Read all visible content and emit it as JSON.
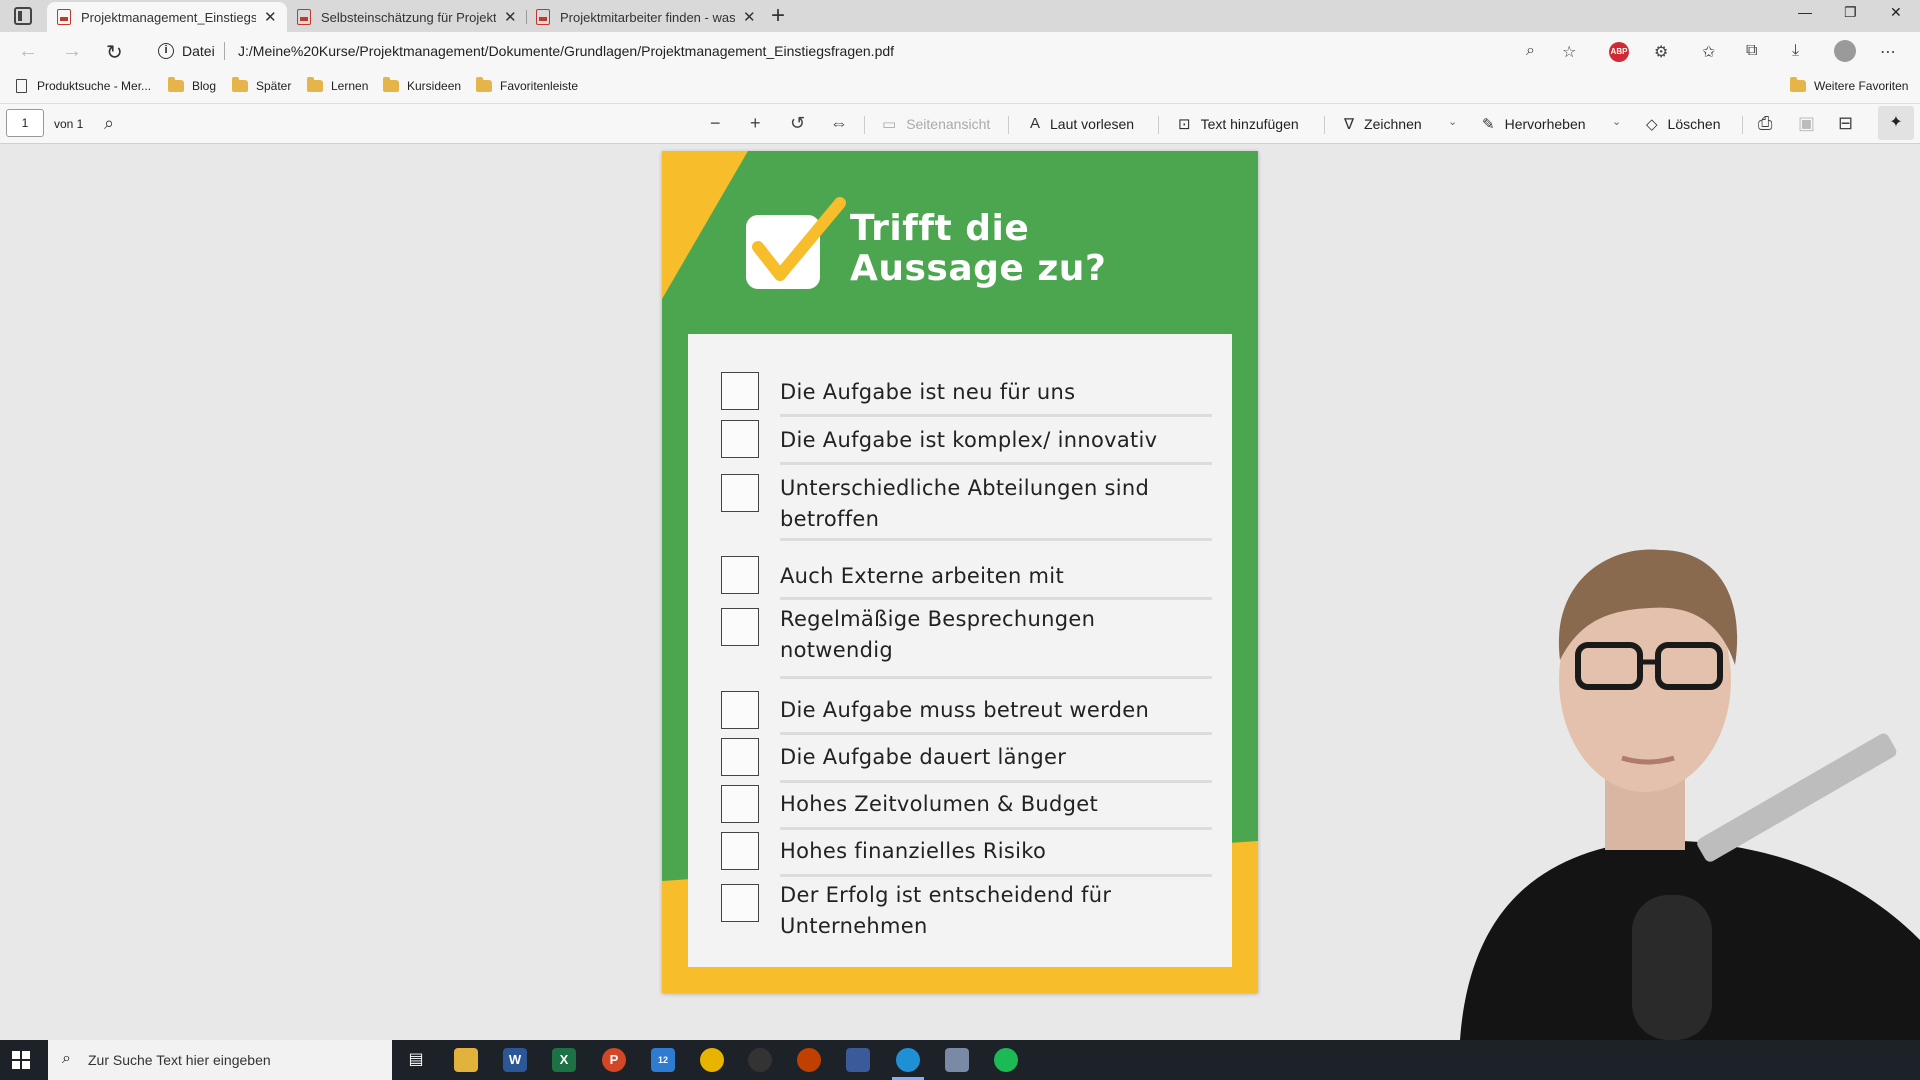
{
  "browser": {
    "tabs": [
      {
        "title": "Projektmanagement_Einstiegsfragen.pdf",
        "active": true
      },
      {
        "title": "Selbsteinschätzung für Projektmanager",
        "active": false
      },
      {
        "title": "Projektmitarbeiter finden - was zu beachten ist",
        "active": false
      }
    ],
    "close_glyph": "✕",
    "new_tab_glyph": "+",
    "address": {
      "protocol_label": "Datei",
      "url": "J:/Meine%20Kurse/Projektmanagement/Dokumente/Grundlagen/Projektmanagement_Einstiegsfragen.pdf"
    },
    "extension_badge": "ABP",
    "bookmarks": [
      {
        "label": "Produktsuche - Mer...",
        "icon": "page-icon"
      },
      {
        "label": "Blog",
        "icon": "folder-icon"
      },
      {
        "label": "Später",
        "icon": "folder-icon"
      },
      {
        "label": "Lernen",
        "icon": "folder-icon"
      },
      {
        "label": "Kursideen",
        "icon": "folder-icon"
      },
      {
        "label": "Favoritenleiste",
        "icon": "folder-icon"
      }
    ],
    "other_favorites": "Weitere Favoriten"
  },
  "pdf_toolbar": {
    "page_number": "1",
    "page_of": "von 1",
    "page_view": "Seitenansicht",
    "read_aloud": "Laut vorlesen",
    "add_text": "Text hinzufügen",
    "draw": "Zeichnen",
    "highlight": "Hervorheben",
    "erase": "Löschen"
  },
  "document": {
    "headline_line1": "Trifft die",
    "headline_line2": "Aussage zu?",
    "colors": {
      "green": "#4ca64f",
      "yellow": "#f7bd2a",
      "card": "#f3f3f3"
    },
    "items": [
      {
        "line1": "Die Aufgabe ist neu für uns",
        "line2": ""
      },
      {
        "line1": "Die Aufgabe ist komplex/ innovativ",
        "line2": ""
      },
      {
        "line1": "Unterschiedliche Abteilungen sind",
        "line2": " betroffen"
      },
      {
        "line1": "Auch Externe arbeiten mit",
        "line2": ""
      },
      {
        "line1": "Regelmäßige Besprechungen",
        "line2": "notwendig"
      },
      {
        "line1": "Die Aufgabe muss betreut werden",
        "line2": ""
      },
      {
        "line1": "Die Aufgabe dauert länger",
        "line2": ""
      },
      {
        "line1": "Hohes Zeitvolumen & Budget",
        "line2": ""
      },
      {
        "line1": "Hohes finanzielles Risiko",
        "line2": ""
      },
      {
        "line1": "Der Erfolg ist entscheidend für",
        "line2": "Unternehmen"
      }
    ]
  },
  "taskbar": {
    "search_placeholder": "Zur Suche Text hier eingeben",
    "mail_badge": "12",
    "app_letters": {
      "word": "W",
      "excel": "X",
      "powerpoint": "P"
    }
  }
}
